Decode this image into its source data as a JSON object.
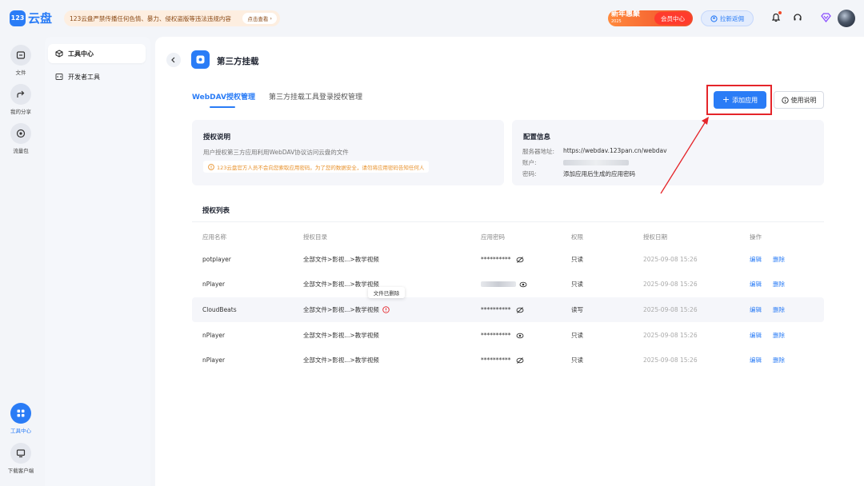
{
  "app": {
    "logo_badge": "123",
    "logo_text": "云盘"
  },
  "notice": {
    "text": "123云盘严禁传播任何色情、暴力、侵权盗版等违法违规内容",
    "button": "点击查看"
  },
  "header": {
    "promo_title": "新年惠聚",
    "promo_year": "2025",
    "promo_button": "会员中心",
    "invite_label": "拉新返佣"
  },
  "rail": {
    "files": "文件",
    "share": "我的分享",
    "traffic": "流量包",
    "tools": "工具中心",
    "download": "下载客户端"
  },
  "submenu": {
    "tool_center": "工具中心",
    "dev_tools": "开发者工具"
  },
  "page": {
    "title": "第三方挂载",
    "tabs": [
      "WebDAV授权管理",
      "第三方挂载工具登录授权管理"
    ],
    "add_button": "添加应用",
    "help_button": "使用说明"
  },
  "auth_card": {
    "title": "授权说明",
    "text": "用户授权第三方应用利用WebDAV协议访问云盘的文件",
    "warning": "123云盘官方人员不会向您索取应用密码。为了您的数据安全，请勿将应用密码告知任何人"
  },
  "config_card": {
    "title": "配置信息",
    "server_label": "服务器地址:",
    "server_value": "https://webdav.123pan.cn/webdav",
    "account_label": "账户:",
    "password_label": "密码:",
    "password_value": "添加应用后生成的应用密码"
  },
  "list": {
    "title": "授权列表",
    "columns": [
      "应用名称",
      "授权目录",
      "应用密码",
      "权限",
      "授权日期",
      "操作"
    ],
    "rows": [
      {
        "name": "potplayer",
        "dir": "全部文件>影视...>教学视频",
        "password": "**********",
        "perm": "只读",
        "date": "2025-09-08 15:26",
        "edit": "编辑",
        "delete": "删除"
      },
      {
        "name": "nPlayer",
        "dir": "全部文件>影视...>教学视频",
        "password": "",
        "perm": "只读",
        "date": "2025-09-08 15:26",
        "edit": "编辑",
        "delete": "删除"
      },
      {
        "name": "CloudBeats",
        "dir": "全部文件>影视...>教学视频",
        "password": "**********",
        "perm": "读写",
        "date": "2025-09-08 15:26",
        "edit": "编辑",
        "delete": "删除"
      },
      {
        "name": "nPlayer",
        "dir": "全部文件>影视...>教学视频",
        "password": "**********",
        "perm": "只读",
        "date": "2025-09-08 15:26",
        "edit": "编辑",
        "delete": "删除"
      },
      {
        "name": "nPlayer",
        "dir": "全部文件>影视...>教学视频",
        "password": "**********",
        "perm": "只读",
        "date": "2025-09-08 15:26",
        "edit": "编辑",
        "delete": "删除"
      }
    ],
    "tooltip": "文件已删除"
  },
  "colors": {
    "accent": "#2a7cf6",
    "annotation": "#e5252a",
    "warning": "#e8912b"
  }
}
